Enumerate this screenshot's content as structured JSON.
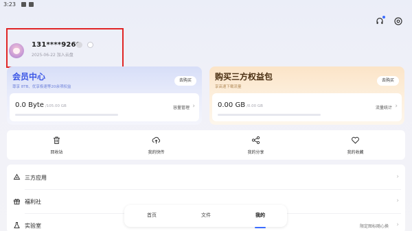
{
  "status_bar": {
    "time": "3:23"
  },
  "header": {
    "support_icon": "headset-icon",
    "settings_icon": "gear-icon"
  },
  "profile": {
    "phone": "131****9260",
    "join_date": "2025-06-22 加入云盘",
    "avatar_icon": "avatar-icon"
  },
  "member_card": {
    "title": "会员中心",
    "subtitle": "尊享 8TB、优享极速等20余项权益",
    "buy_label": "去购买",
    "used": "0.0 Byte",
    "total": "/105.00 GB",
    "action": "容量管理",
    "usage_fraction": 0.0,
    "accent": "#3c57e6"
  },
  "pack_card": {
    "title": "购买三方权益包",
    "subtitle": "享高速下载流量",
    "buy_label": "去购买",
    "used": "0.00 GB",
    "total": "/0.00 GB",
    "action": "流量统计",
    "usage_fraction": 0.0,
    "accent": "#4a2f12"
  },
  "quick_actions": [
    {
      "label": "回收站",
      "icon": "trash-icon"
    },
    {
      "label": "我的快传",
      "icon": "cloud-upload-icon"
    },
    {
      "label": "我的分享",
      "icon": "share-icon"
    },
    {
      "label": "我的收藏",
      "icon": "heart-icon"
    }
  ],
  "list_items": [
    {
      "label": "三方应用",
      "icon": "recycle-icon",
      "extra": ""
    },
    {
      "label": "福利社",
      "icon": "gift-icon",
      "extra": ""
    },
    {
      "label": "实验室",
      "icon": "lab-icon",
      "extra": "限定图标随心换"
    }
  ],
  "bottom_nav": {
    "tabs": [
      {
        "label": "首页",
        "active": false
      },
      {
        "label": "文件",
        "active": false
      },
      {
        "label": "我的",
        "active": true
      }
    ],
    "accent": "#3b6cff"
  }
}
